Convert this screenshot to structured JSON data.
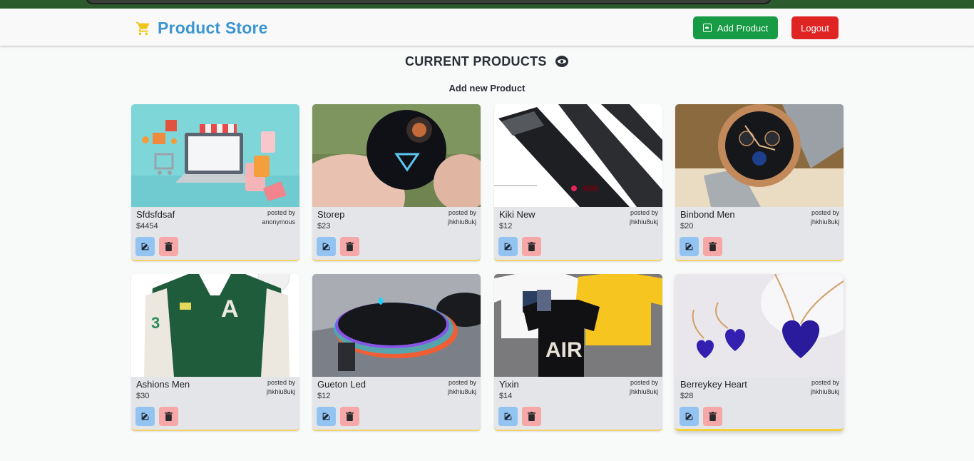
{
  "brand": {
    "title": "Product Store",
    "icon": "cart-icon",
    "icon_color": "#f0c419",
    "title_color": "#3b95d0"
  },
  "nav": {
    "add_label": "Add Product",
    "logout_label": "Logout",
    "add_color": "#179b44",
    "logout_color": "#e02424"
  },
  "main": {
    "heading": "CURRENT PRODUCTS",
    "heading_icon": "eye-icon",
    "subheading": "Add new Product"
  },
  "products": [
    {
      "name": "Sfdsfdsaf",
      "price": "$4454",
      "posted_label": "posted by",
      "posted_by": "anonymous",
      "image": "shopping-laptop-image"
    },
    {
      "name": "Storep",
      "price": "$23",
      "posted_label": "posted by",
      "posted_by": "jhkhiu8ukj",
      "image": "360-camera-image"
    },
    {
      "name": "Kiki New",
      "price": "$12",
      "posted_label": "posted by",
      "posted_by": "jhkhiu8ukj",
      "image": "hair-clipper-image"
    },
    {
      "name": "Binbond Men",
      "price": "$20",
      "posted_label": "posted by",
      "posted_by": "jhkhiu8ukj",
      "image": "wrist-watch-image"
    },
    {
      "name": "Ashions Men",
      "price": "$30",
      "posted_label": "posted by",
      "posted_by": "jhkhiu8ukj",
      "image": "varsity-jacket-image"
    },
    {
      "name": "Gueton Led",
      "price": "$12",
      "posted_label": "posted by",
      "posted_by": "jhkhiu8ukj",
      "image": "rgb-mouse-image"
    },
    {
      "name": "Yixin",
      "price": "$14",
      "posted_label": "posted by",
      "posted_by": "jhkhiu8ukj",
      "image": "tshirts-image"
    },
    {
      "name": "Berreykey Heart",
      "price": "$28",
      "posted_label": "posted by",
      "posted_by": "jhkhiu8ukj",
      "image": "heart-necklace-image"
    }
  ],
  "actions": {
    "edit_icon": "edit-icon",
    "delete_icon": "trash-icon"
  }
}
